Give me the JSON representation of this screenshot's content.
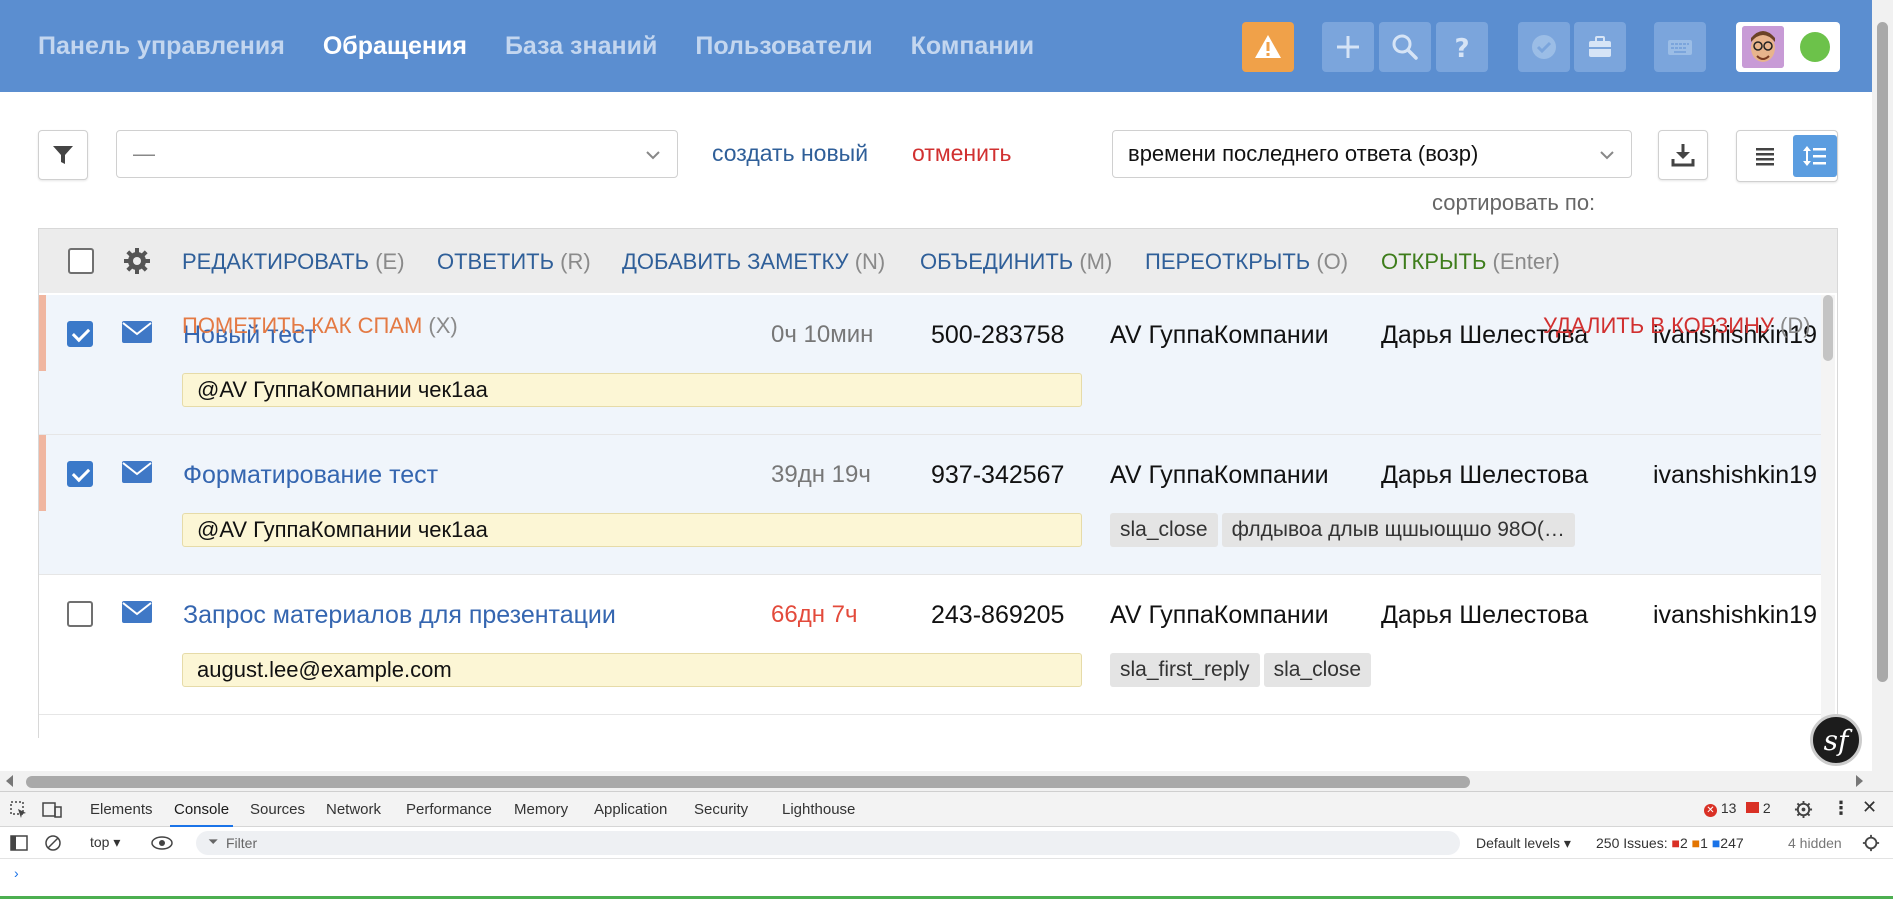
{
  "nav": {
    "links": [
      "Панель управления",
      "Обращения",
      "База знаний",
      "Пользователи",
      "Компании"
    ],
    "active_index": 1
  },
  "toolbar": {
    "view_value": "—",
    "create_label": "создать новый",
    "cancel_label": "отменить",
    "sort_value": "времени последнего ответа (возр)",
    "sort_label": "сортировать по:"
  },
  "actions": {
    "edit": {
      "label": "РЕДАКТИРОВАТЬ",
      "key": "(E)"
    },
    "reply": {
      "label": "ОТВЕТИТЬ",
      "key": "(R)"
    },
    "note": {
      "label": "ДОБАВИТЬ ЗАМЕТКУ",
      "key": "(N)"
    },
    "merge": {
      "label": "ОБЪЕДИНИТЬ",
      "key": "(M)"
    },
    "reopen": {
      "label": "ПЕРЕОТКРЫТЬ",
      "key": "(O)"
    },
    "open": {
      "label": "ОТКРЫТЬ",
      "key": "(Enter)"
    },
    "spam": {
      "label": "ПОМЕТИТЬ КАК СПАМ",
      "key": "(X)"
    },
    "delete": {
      "label": "УДАЛИТЬ В КОРЗИНУ",
      "key": "(D)"
    }
  },
  "tickets": [
    {
      "subject": "Новый тест",
      "time": "0ч 10мин",
      "overdue": false,
      "number": "500-283758",
      "company": "AV ГуппаКомпании",
      "agent": "Дарья Шелестова",
      "creator": "ivanshishkin19",
      "note": "@AV ГуппаКомпании чек1аа",
      "tags": [],
      "checked": true
    },
    {
      "subject": "Форматирование тест",
      "time": "39дн 19ч",
      "overdue": false,
      "number": "937-342567",
      "company": "AV ГуппаКомпании",
      "agent": "Дарья Шелестова",
      "creator": "ivanshishkin19",
      "note": "@AV ГуппаКомпании чек1аа",
      "tags": [
        "sla_close",
        "флдывоа длыв щшыощшо 98О(…"
      ],
      "checked": true
    },
    {
      "subject": "Запрос материалов для презентации",
      "time": "66дн 7ч",
      "overdue": true,
      "number": "243-869205",
      "company": "AV ГуппаКомпании",
      "agent": "Дарья Шелестова",
      "creator": "ivanshishkin19",
      "note": "august.lee@example.com",
      "tags": [
        "sla_first_reply",
        "sla_close"
      ],
      "checked": false
    }
  ],
  "devtools": {
    "tabs": [
      "Elements",
      "Console",
      "Sources",
      "Network",
      "Performance",
      "Memory",
      "Application",
      "Security",
      "Lighthouse"
    ],
    "active_tab": "Console",
    "error_count": "13",
    "warning_count": "2",
    "context": "top",
    "filter_placeholder": "Filter",
    "levels": "Default levels",
    "issues_label": "250 Issues:",
    "issues_errors": "2",
    "issues_warnings": "1",
    "issues_info": "247",
    "hidden": "4 hidden",
    "prompt": "›"
  },
  "colors": {
    "navbar": "#5b8ed0",
    "warning_button": "#f0a149",
    "link_blue": "#2f5f99",
    "cancel_red": "#d13030",
    "open_green": "#3e7d1b",
    "spam_orange": "#e47a44",
    "overdue_red": "#e34a3b"
  }
}
